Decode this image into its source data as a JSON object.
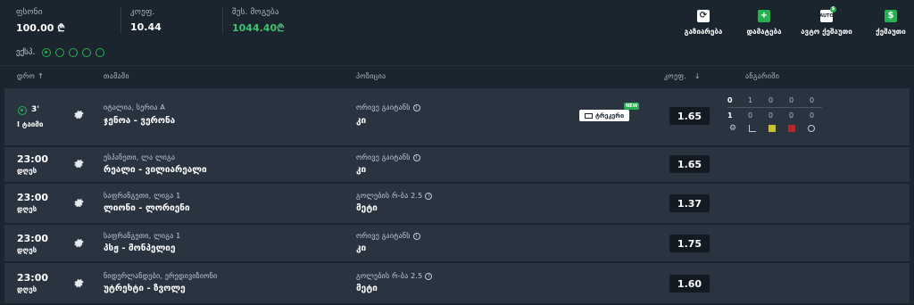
{
  "header": {
    "stake": {
      "label": "ფსონი",
      "value": "100.00 ₾"
    },
    "odds": {
      "label": "კოეფ.",
      "value": "10.44"
    },
    "potential": {
      "label": "შეს. მოგება",
      "value": "1044.40₾"
    },
    "actions": [
      {
        "label": "გაზიარება",
        "icon": "refresh-icon"
      },
      {
        "label": "დამატება",
        "icon": "plus-icon"
      },
      {
        "label": "ავტო ქეშაუთი",
        "icon": "auto-icon"
      },
      {
        "label": "ქეშაუთი",
        "icon": "dollar-icon"
      }
    ]
  },
  "express": {
    "label": "ექსპ."
  },
  "columns": {
    "date": "დრო",
    "event": "თამაში",
    "position": "პოზიცია",
    "odds": "კოეფ.",
    "analysis": "ანგარიში"
  },
  "rows": [
    {
      "minute": "3'",
      "period": "I ტაიმი",
      "league": "იტალია, სერია A",
      "teams": "ჯენოა - ვერონა",
      "market": "ორივე გაიტანს",
      "selection": "კი",
      "odds": "1.65",
      "tracker": "ტრეკერი",
      "tracker_badge": "NEW",
      "score": {
        "row1": [
          "0",
          "1",
          "0",
          "0",
          "0"
        ],
        "row2": [
          "1",
          "0",
          "0",
          "0",
          "0"
        ]
      }
    },
    {
      "time": "23:00",
      "day": "დღეს",
      "league": "ესპანეთი, ლა ლიგა",
      "teams": "რეალი - ვილიარეალი",
      "market": "ორივე გაიტანს",
      "selection": "კი",
      "odds": "1.65"
    },
    {
      "time": "23:00",
      "day": "დღეს",
      "league": "საფრანგეთი, ლიგა 1",
      "teams": "ლიონი - ლორიენი",
      "market": "გოლების რ-ბა 2.5",
      "selection": "მეტი",
      "odds": "1.37"
    },
    {
      "time": "23:00",
      "day": "დღეს",
      "league": "საფრანგეთი, ლიგა 1",
      "teams": "პსჟ - მონპელიე",
      "market": "ორივე გაიტანს",
      "selection": "კი",
      "odds": "1.75"
    },
    {
      "time": "23:00",
      "day": "დღეს",
      "league": "ნიდერლანდები, ერედივიზიონი",
      "teams": "უტრეხტი - ზვოლე",
      "market": "გოლების რ-ბა 2.5",
      "selection": "მეტი",
      "odds": "1.60"
    }
  ]
}
